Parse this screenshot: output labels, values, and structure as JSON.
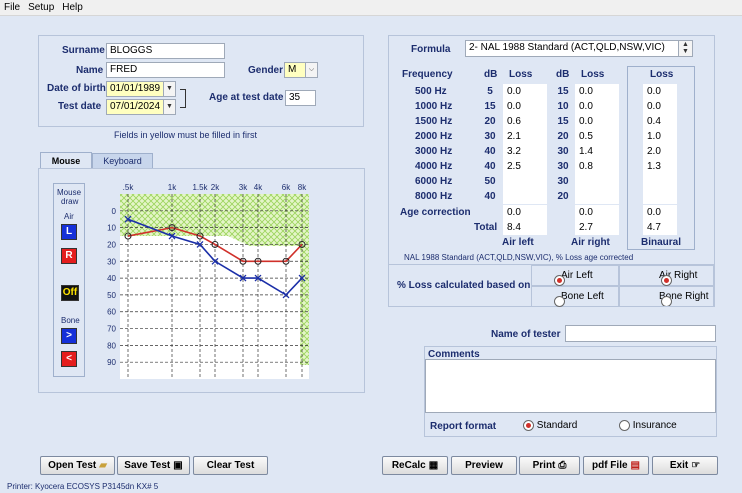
{
  "menu": {
    "file": "File",
    "setup": "Setup",
    "help": "Help"
  },
  "patient": {
    "surname_label": "Surname",
    "surname": "BLOGGS",
    "name_label": "Name",
    "name": "FRED",
    "gender_label": "Gender",
    "gender": "M",
    "dob_label": "Date of birth",
    "dob": "01/01/1989",
    "test_date_label": "Test date",
    "test_date": "07/01/2024",
    "age_label": "Age at test date",
    "age": "35"
  },
  "note": "Fields in yellow must be filled in first",
  "tabs": {
    "mouse": "Mouse",
    "keyboard": "Keyboard"
  },
  "tools": {
    "title_line1": "Mouse",
    "title_line2": "draw",
    "air": "Air",
    "left": "L",
    "right": "R",
    "off": "Off",
    "bone": "Bone",
    "bone_left": ">",
    "bone_right": "<"
  },
  "audiogram": {
    "freq_labels": [
      ".5k",
      "1k",
      "1.5k",
      "2k",
      "3k",
      "4k",
      "6k",
      "8k"
    ],
    "db_labels": [
      "0",
      "10",
      "20",
      "30",
      "40",
      "50",
      "60",
      "70",
      "80",
      "90"
    ]
  },
  "chart_data": {
    "type": "line",
    "title": "",
    "x": [
      ".5k",
      "1k",
      "1.5k",
      "2k",
      "3k",
      "4k",
      "6k",
      "8k"
    ],
    "y_range": [
      -10,
      100
    ],
    "y_inverted": true,
    "series": [
      {
        "name": "",
        "color": "#d0302a",
        "marker": "circle",
        "values": [
          15,
          10,
          15,
          20,
          30,
          30,
          30,
          20
        ]
      },
      {
        "name": "",
        "color": "#1b2fa8",
        "marker": "x",
        "values": [
          5,
          15,
          20,
          30,
          40,
          40,
          50,
          40
        ]
      }
    ]
  },
  "formula": {
    "label": "Formula",
    "value": "2-  NAL 1988  Standard  (ACT,QLD,NSW,VIC)"
  },
  "table": {
    "frequency_header": "Frequency",
    "db_header": "dB",
    "loss_header": "Loss",
    "freqs": [
      "500 Hz",
      "1000 Hz",
      "1500 Hz",
      "2000 Hz",
      "3000 Hz",
      "4000 Hz",
      "6000 Hz",
      "8000 Hz"
    ],
    "left_db": [
      "5",
      "15",
      "20",
      "30",
      "40",
      "40",
      "50",
      "40"
    ],
    "left_loss": [
      "0.0",
      "0.0",
      "0.6",
      "2.1",
      "3.2",
      "2.5",
      "",
      ""
    ],
    "right_db": [
      "15",
      "10",
      "15",
      "20",
      "30",
      "30",
      "30",
      "20"
    ],
    "right_loss": [
      "0.0",
      "0.0",
      "0.0",
      "0.5",
      "1.4",
      "0.8",
      "",
      ""
    ],
    "bin_loss": [
      "0.0",
      "0.0",
      "0.4",
      "1.0",
      "2.0",
      "1.3",
      "",
      ""
    ],
    "age_correction_label": "Age correction",
    "age_corr_left": "0.0",
    "age_corr_right": "0.0",
    "age_corr_bin": "0.0",
    "total_label": "Total",
    "total_left": "8.4",
    "total_right": "2.7",
    "total_bin": "4.7",
    "air_left": "Air left",
    "air_right": "Air right",
    "binaural": "Binaural"
  },
  "standard_note": "NAL 1988  Standard   (ACT,QLD,NSW,VIC), % Loss age corrected",
  "calc": {
    "label": "% Loss calculated based on",
    "air_left": "Air Left",
    "air_right": "Air Right",
    "bone_left": "Bone Left",
    "bone_right": "Bone Right"
  },
  "tester": {
    "label": "Name of tester",
    "value": ""
  },
  "comments": {
    "label": "Comments",
    "value": ""
  },
  "report": {
    "label": "Report format",
    "standard": "Standard",
    "insurance": "Insurance"
  },
  "buttons": {
    "open": "Open Test",
    "save": "Save Test",
    "clear": "Clear Test",
    "recalc": "ReCalc",
    "preview": "Preview",
    "print": "Print",
    "pdf": "pdf File",
    "exit": "Exit"
  },
  "status": "Printer: Kyocera ECOSYS P3145dn KX# 5"
}
